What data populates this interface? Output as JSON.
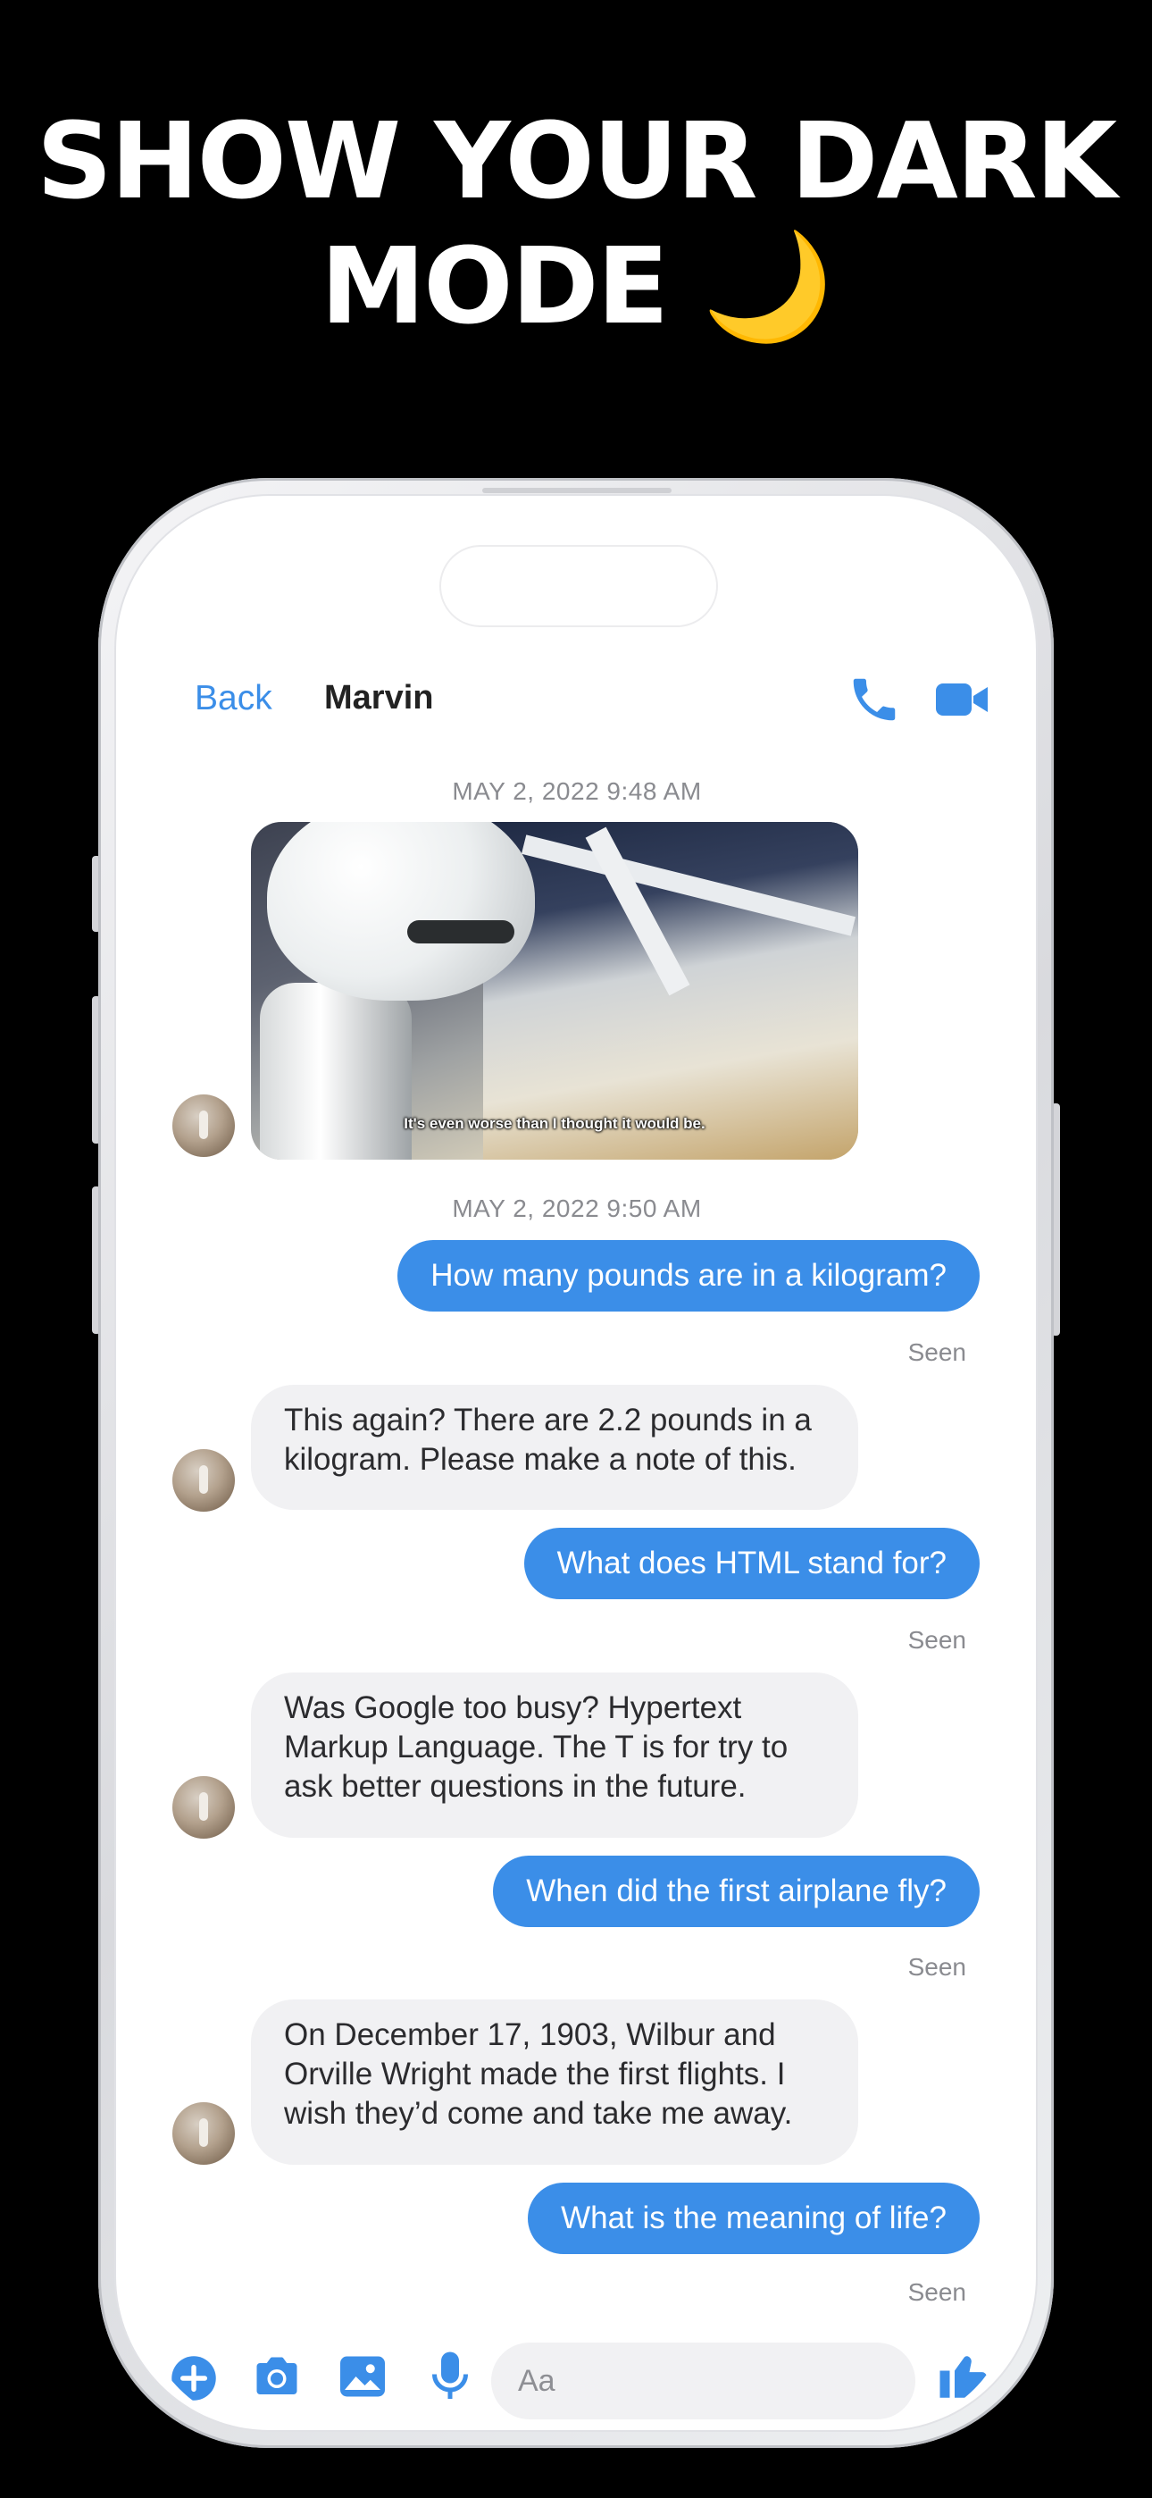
{
  "promo": {
    "headline": "SHOW YOUR DARK MODE",
    "moon_glyph": "🌙"
  },
  "header": {
    "back_label": "Back",
    "contact_name": "Marvin",
    "call_icon": "phone-icon",
    "video_icon": "video-camera-icon"
  },
  "thread": {
    "timestamps": [
      "MAY 2, 2022 9:48 AM",
      "MAY 2, 2022 9:50 AM"
    ],
    "media": {
      "caption": "It's even worse than I thought it would be."
    },
    "messages": [
      {
        "from": "me",
        "text": "How many pounds are in a kilogram?",
        "status": "Seen"
      },
      {
        "from": "Marvin",
        "text": "This again? There are 2.2 pounds in a kilogram. Please make a note of this."
      },
      {
        "from": "me",
        "text": "What does HTML stand for?",
        "status": "Seen"
      },
      {
        "from": "Marvin",
        "text": "Was Google too busy? Hypertext Markup Language. The T is for try to ask better questions in the future."
      },
      {
        "from": "me",
        "text": "When did the first airplane fly?",
        "status": "Seen"
      },
      {
        "from": "Marvin",
        "text": "On December 17, 1903, Wilbur and Orville Wright made the first flights. I wish they’d come and take me away."
      },
      {
        "from": "me",
        "text": "What is the meaning of life?",
        "status": "Seen"
      }
    ]
  },
  "composer": {
    "placeholder": "Aa",
    "icons": [
      "plus-circle-icon",
      "camera-icon",
      "gallery-icon",
      "microphone-icon",
      "thumbs-up-icon"
    ]
  },
  "colors": {
    "accent": "#3b8ee8",
    "incoming_bubble": "#f1f1f3",
    "background": "#000000"
  }
}
